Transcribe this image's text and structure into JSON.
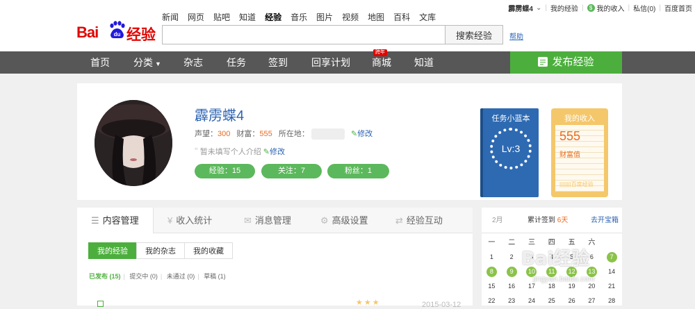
{
  "top_nav": [
    "新闻",
    "网页",
    "贴吧",
    "知道",
    "经验",
    "音乐",
    "图片",
    "视频",
    "地图",
    "百科",
    "文库"
  ],
  "top_nav_active": "经验",
  "logo": {
    "bai": "Bai",
    "du": "du",
    "jy": "经验"
  },
  "search": {
    "value": "",
    "button": "搜索经验",
    "help": "帮助"
  },
  "userbar": {
    "username": "霹雳蝶4",
    "my_exp": "我的经验",
    "income": "我的收入",
    "messages": "私信(0)",
    "home": "百度首页"
  },
  "nav": {
    "items": [
      "首页",
      "分类",
      "杂志",
      "任务",
      "签到",
      "回享计划",
      "商城",
      "知道"
    ],
    "badge": "跨年",
    "publish": "发布经验"
  },
  "profile": {
    "name": "霹雳蝶4",
    "reputation_label": "声望：",
    "reputation": "300",
    "wealth_label": "财富：",
    "wealth": "555",
    "location_label": "所在地：",
    "edit": "修改",
    "intro": "暂未填写个人介绍",
    "pills": [
      "经验：15",
      "关注：7",
      "粉丝：1"
    ],
    "taskbook_title": "任务小蓝本",
    "level": "Lv:3",
    "income_title": "我的收入",
    "income_value": "555",
    "income_label": "财富值",
    "income_footer": "百度经验"
  },
  "content": {
    "tabs": [
      "内容管理",
      "收入统计",
      "消息管理",
      "高级设置",
      "经验互动"
    ],
    "subtabs": [
      "我的经验",
      "我的杂志",
      "我的收藏"
    ],
    "filters": [
      "已发布 (15)",
      "提交中 (0)",
      "未通过 (0)",
      "草稿 (1)"
    ],
    "row_date": "2015-03-12"
  },
  "calendar": {
    "month": "2月",
    "streak_label": "累计签到",
    "streak_value": "6天",
    "open": "去开宝箱",
    "weekdays": [
      "一",
      "二",
      "三",
      "四",
      "五",
      "六"
    ],
    "rows": [
      [
        [
          "1",
          false
        ],
        [
          "2",
          false
        ],
        [
          "3",
          false
        ],
        [
          "4",
          false
        ],
        [
          "5",
          false
        ],
        [
          "6",
          false
        ],
        [
          "7",
          true
        ]
      ],
      [
        [
          "8",
          true
        ],
        [
          "9",
          true
        ],
        [
          "10",
          true
        ],
        [
          "11",
          true
        ],
        [
          "12",
          true
        ],
        [
          "13",
          true
        ],
        [
          "14",
          false
        ]
      ],
      [
        [
          "15",
          false
        ],
        [
          "16",
          false
        ],
        [
          "17",
          false
        ],
        [
          "18",
          false
        ],
        [
          "19",
          false
        ],
        [
          "20",
          false
        ],
        [
          "21",
          false
        ]
      ],
      [
        [
          "22",
          false
        ],
        [
          "23",
          false
        ],
        [
          "24",
          false
        ],
        [
          "25",
          false
        ],
        [
          "26",
          false
        ],
        [
          "27",
          false
        ],
        [
          "28",
          false
        ]
      ]
    ]
  },
  "watermark": "Bai经验",
  "watermark_url": "jingyan.baidu.com",
  "colors": {
    "accent_green": "#4caf3d",
    "nav_gray": "#575757",
    "brand_red": "#e10602",
    "link_blue": "#2d64b3",
    "wealth_orange": "#e96a1e"
  }
}
